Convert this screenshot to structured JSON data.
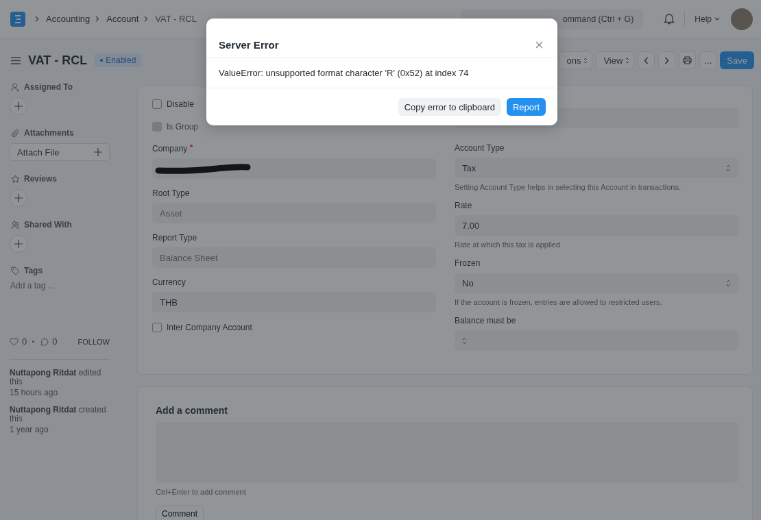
{
  "navbar": {
    "breadcrumbs": [
      "Accounting",
      "Account",
      "VAT - RCL"
    ],
    "search": {
      "placeholder": "ommand (Ctrl + G)"
    },
    "help": "Help"
  },
  "header": {
    "title": "VAT - RCL",
    "status": "Enabled",
    "buttons": [
      {
        "kind": "dropdown",
        "label": "ons"
      },
      {
        "kind": "dropdown",
        "label": "View"
      },
      {
        "kind": "prev"
      },
      {
        "kind": "next"
      },
      {
        "kind": "print"
      },
      {
        "kind": "more",
        "label": "..."
      }
    ],
    "save": "Save"
  },
  "sidebar": {
    "sections": [
      {
        "kind": "add",
        "label": "Assigned To"
      },
      {
        "kind": "attach",
        "label": "Attachments",
        "button": "Attach File"
      },
      {
        "kind": "add",
        "label": "Reviews"
      },
      {
        "kind": "add",
        "label": "Shared With"
      },
      {
        "kind": "tags",
        "label": "Tags",
        "placeholder": "Add a tag ..."
      }
    ],
    "likes": "0",
    "comments": "0",
    "follow": "FOLLOW",
    "activity": [
      {
        "text": "**Nuttapong Ritdat** edited this",
        "time": "15 hours ago"
      },
      {
        "text": "**Nuttapong Ritdat** created this",
        "time": "1 year ago"
      }
    ]
  },
  "form": {
    "left": [
      {
        "kind": "check",
        "label": "Disable",
        "checked": false,
        "disabled": false
      },
      {
        "kind": "check",
        "label": "Is Group",
        "checked": false,
        "disabled": true
      },
      {
        "kind": "input",
        "label": "Company",
        "required": true,
        "redacted": true
      },
      {
        "kind": "input",
        "label": "Root Type",
        "value": "Asset",
        "read_only": true
      },
      {
        "kind": "input",
        "label": "Report Type",
        "value": "Balance Sheet",
        "read_only": true
      },
      {
        "kind": "input",
        "label": "Currency",
        "value": "THB",
        "read_only": false
      },
      {
        "kind": "check",
        "label": "Inter Company Account",
        "checked": false,
        "disabled": false
      }
    ],
    "right": [
      {
        "kind": "input"
      },
      {
        "kind": "select",
        "label": "Account Type",
        "value": "Tax",
        "description": "Setting Account Type helps in selecting this Account in transactions."
      },
      {
        "kind": "input",
        "label": "Rate",
        "value": "7.00",
        "read_only": false,
        "description": "Rate at which this tax is applied"
      },
      {
        "kind": "select",
        "label": "Frozen",
        "value": "No",
        "description": "If the account is frozen, entries are allowed to restricted users."
      },
      {
        "kind": "select",
        "label": "Balance must be"
      }
    ]
  },
  "comment": {
    "title": "Add a comment",
    "hint": "Ctrl+Enter to add comment",
    "button": "Comment"
  },
  "modal": {
    "title": "Server Error",
    "message": "ValueError: unsupported format character 'R' (0x52) at index 74",
    "buttons": [
      {
        "label": "Copy error to clipboard",
        "primary": false
      },
      {
        "label": "Report",
        "primary": true
      }
    ]
  }
}
